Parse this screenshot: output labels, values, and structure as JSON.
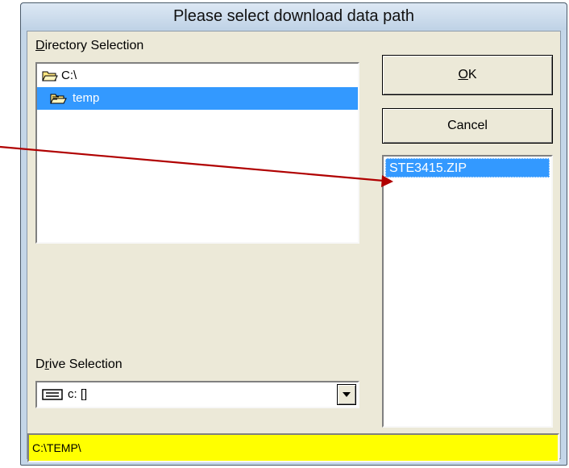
{
  "dialog": {
    "title": "Please select download data path"
  },
  "directory_selection": {
    "label_mnemonic": "D",
    "label_rest": "irectory Selection",
    "items": [
      {
        "label": "C:\\",
        "state": "open"
      },
      {
        "label": "temp",
        "state": "open-selected"
      }
    ]
  },
  "drive_selection": {
    "label_pre": "D",
    "label_mnemonic": "r",
    "label_rest": "ive Selection",
    "value": "c: []"
  },
  "buttons": {
    "ok_mnemonic": "O",
    "ok_rest": "K",
    "cancel_label": "Cancel"
  },
  "file_list": {
    "items": [
      {
        "label": "STE3415.ZIP",
        "selected": true
      }
    ]
  },
  "path_display": {
    "value": "C:\\TEMP\\",
    "background": "#ffff00"
  },
  "annotation": {
    "arrow_color": "#b00000"
  },
  "colors": {
    "selection": "#3399ff"
  }
}
